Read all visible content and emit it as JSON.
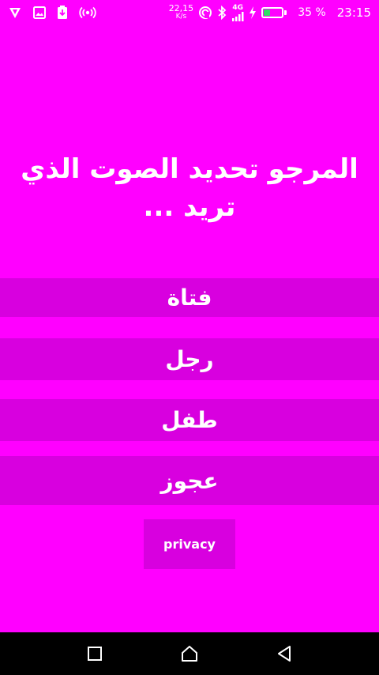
{
  "status_bar": {
    "speed_value": "22,15",
    "speed_unit": "K/s",
    "network": "4G",
    "battery_percent": "35 %",
    "battery_level": 0.35,
    "time": "23:15",
    "icons": [
      "shield-icon",
      "image-icon",
      "download-icon",
      "hotspot-icon",
      "nfc-icon",
      "bluetooth-icon",
      "signal-icon",
      "charging-icon",
      "battery-icon"
    ]
  },
  "prompt": {
    "title": "المرجو تحديد الصوت الذي تريد ..."
  },
  "choices": [
    {
      "label": "فتاة"
    },
    {
      "label": "رجل"
    },
    {
      "label": "طفل"
    },
    {
      "label": "عجوز"
    }
  ],
  "privacy_button": {
    "label": "privacy"
  },
  "colors": {
    "background": "#ff00ff",
    "button": "#d800df",
    "text": "#ffffff"
  }
}
